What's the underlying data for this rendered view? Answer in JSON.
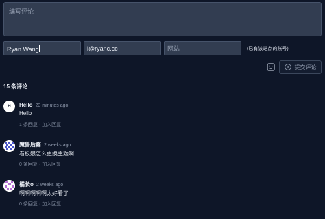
{
  "form": {
    "textarea_placeholder": "编写评论",
    "name_value": "Ryan Wang",
    "email_value": "i@ryanc.cc",
    "website_placeholder": "网站",
    "account_hint": "(已有该站点的账号)",
    "submit_label": "提交评论",
    "emoji_icon": "emoji-icon",
    "submit_icon": "send-icon"
  },
  "comments_count_label": "15 条评论",
  "comments": [
    {
      "avatar_letter": "H",
      "author": "Hello",
      "time": "23 minutes ago",
      "body": "Hello",
      "reply_count": "1 条回复",
      "separator": "·",
      "reply_action": "加入回复"
    },
    {
      "avatar_letter": "",
      "author": "魔兽后裔",
      "time": "2 weeks ago",
      "body": "看板娘怎么更换主题啊",
      "reply_count": "0 条回复",
      "separator": "·",
      "reply_action": "加入回复"
    },
    {
      "avatar_letter": "",
      "author": "橘长o",
      "time": "2 weeks ago",
      "body": "啊啊啊啊啊太好看了",
      "reply_count": "0 条回复",
      "separator": "·",
      "reply_action": "加入回复"
    }
  ],
  "colors": {
    "background": "#0e1628",
    "input_background": "#323d51",
    "avatar2": "#4a56c8",
    "avatar3": "#b46fd3"
  }
}
